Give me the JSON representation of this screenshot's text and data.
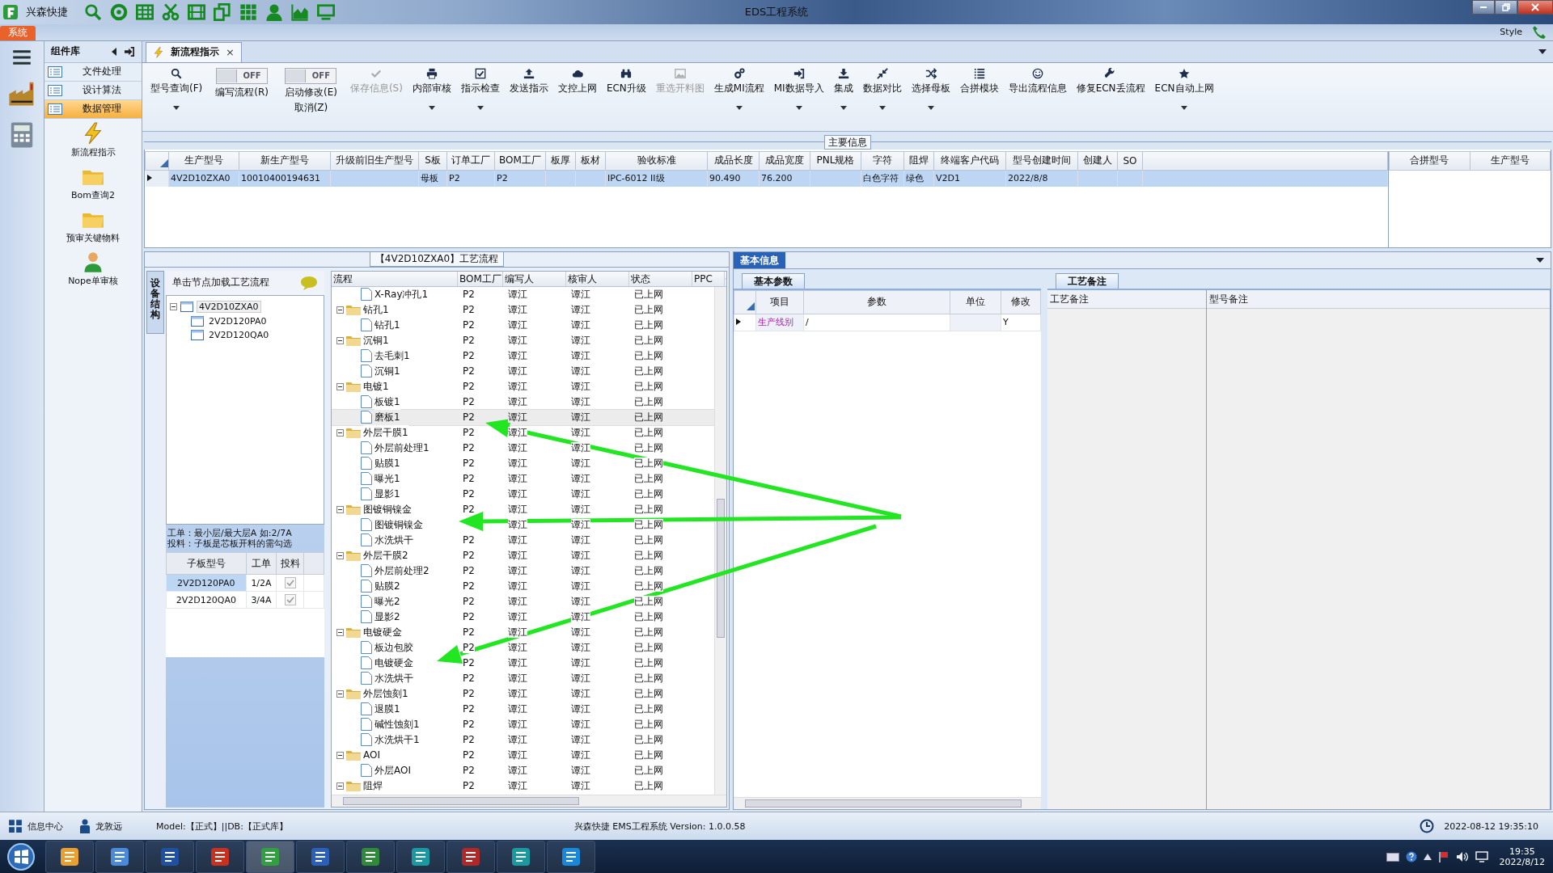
{
  "title_bar": {
    "app_name": "兴森快捷",
    "title": "EDS工程系统"
  },
  "ribbon": {
    "tab": "系统",
    "style_menu": "Style"
  },
  "component_panel": {
    "title": "组件库",
    "categories": [
      {
        "label": "文件处理",
        "selected": false
      },
      {
        "label": "设计算法",
        "selected": false
      },
      {
        "label": "数据管理",
        "selected": true
      }
    ],
    "modules": [
      "新流程指示",
      "Bom查询2",
      "预审关键物料",
      "Nope单审核"
    ]
  },
  "document_tab": {
    "label": "新流程指示",
    "close": "×"
  },
  "toolbar": [
    {
      "kind": "button",
      "label": "型号查询(F)",
      "dropdown": true,
      "disabled": false
    },
    {
      "kind": "toggle",
      "label": "编写流程(R)",
      "switch_text": "OFF",
      "on": false
    },
    {
      "kind": "toggle",
      "label": "启动修改(E)",
      "sublabel": "取消(Z)",
      "switch_text": "OFF",
      "on": false
    },
    {
      "kind": "button",
      "label": "保存信息(S)",
      "dropdown": false,
      "disabled": true
    },
    {
      "kind": "button",
      "label": "内部审核",
      "dropdown": true,
      "disabled": false
    },
    {
      "kind": "button",
      "label": "指示检查",
      "dropdown": true,
      "disabled": false
    },
    {
      "kind": "button",
      "label": "发送指示",
      "dropdown": false,
      "disabled": false
    },
    {
      "kind": "button",
      "label": "文控上网",
      "dropdown": false,
      "disabled": false
    },
    {
      "kind": "button",
      "label": "ECN升级",
      "dropdown": false,
      "disabled": false
    },
    {
      "kind": "button",
      "label": "重选开料图",
      "dropdown": false,
      "disabled": true
    },
    {
      "kind": "button",
      "label": "生成MI流程",
      "dropdown": true,
      "disabled": false
    },
    {
      "kind": "button",
      "label": "MI数据导入",
      "dropdown": true,
      "disabled": false
    },
    {
      "kind": "button",
      "label": "集成",
      "dropdown": true,
      "disabled": false
    },
    {
      "kind": "button",
      "label": "数据对比",
      "dropdown": true,
      "disabled": false
    },
    {
      "kind": "button",
      "label": "选择母板",
      "dropdown": true,
      "disabled": false
    },
    {
      "kind": "button",
      "label": "合拼模块",
      "dropdown": false,
      "disabled": false
    },
    {
      "kind": "button",
      "label": "导出流程信息",
      "dropdown": false,
      "disabled": false
    },
    {
      "kind": "button",
      "label": "修复ECN丢流程",
      "dropdown": false,
      "disabled": false
    },
    {
      "kind": "button",
      "label": "ECN自动上网",
      "dropdown": true,
      "disabled": false
    }
  ],
  "main_info": {
    "title": "主要信息",
    "columns": [
      "生产型号",
      "新生产型号",
      "升级前旧生产型号",
      "S板",
      "订单工厂",
      "BOM工厂",
      "板厚",
      "板材",
      "验收标准",
      "成品长度",
      "成品宽度",
      "PNL规格",
      "字符",
      "阻焊",
      "终端客户代码",
      "型号创建时间",
      "创建人",
      "SO"
    ],
    "rows": [
      {
        "selected": true,
        "cells": [
          "4V2D10ZXA0",
          "10010400194631",
          null,
          "母板",
          "P2",
          "P2",
          null,
          null,
          "IPC-6012 II级",
          "90.490",
          "76.200",
          null,
          "白色字符",
          "绿色",
          "V2D1",
          "2022/8/8",
          null,
          null
        ]
      }
    ],
    "merge_table": {
      "columns": [
        "合拼型号",
        "生产型号"
      ]
    }
  },
  "process_panel": {
    "title": "【4V2D10ZXA0】工艺流程",
    "side_tab": "设备结构",
    "tree_header": "单击节点加载工艺流程",
    "tree": [
      {
        "label": "4V2D10ZXA0",
        "expanded": true,
        "selected": true,
        "children": [
          {
            "label": "2V2D120PA0",
            "selected": false
          },
          {
            "label": "2V2D120QA0",
            "selected": false
          }
        ]
      }
    ],
    "note": [
      "工单：最小层/最大层A 如:2/7A",
      "投料：子板是芯板开料的需勾选"
    ],
    "sub_boards": {
      "columns": [
        "子板型号",
        "工单",
        "投料"
      ],
      "rows": [
        {
          "board": "2V2D120PA0",
          "order": "1/2A",
          "feed": true,
          "selected": true
        },
        {
          "board": "2V2D120QA0",
          "order": "3/4A",
          "feed": true,
          "selected": false
        }
      ]
    },
    "flow": {
      "columns": [
        "流程",
        "BOM工厂",
        "编写人",
        "核审人",
        "状态",
        "PPC"
      ],
      "steps": [
        {
          "kind": "folder",
          "children": [
            {
              "kind": "step",
              "label": "X-Ray冲孔1",
              "bom": "P2",
              "writer": "谭江",
              "reviewer": "谭江",
              "status": "已上网",
              "selected": false
            }
          ]
        },
        {
          "kind": "folder",
          "label": "钻孔1",
          "bom": "P2",
          "writer": "谭江",
          "reviewer": "谭江",
          "status": "已上网",
          "selected": false,
          "expanded": true,
          "children": [
            {
              "kind": "step",
              "label": "钻孔1",
              "bom": "P2",
              "writer": "谭江",
              "reviewer": "谭江",
              "status": "已上网",
              "selected": false
            }
          ]
        },
        {
          "kind": "folder",
          "label": "沉铜1",
          "bom": "P2",
          "writer": "谭江",
          "reviewer": "谭江",
          "status": "已上网",
          "selected": false,
          "expanded": true,
          "children": [
            {
              "kind": "step",
              "label": "去毛刺1",
              "bom": "P2",
              "writer": "谭江",
              "reviewer": "谭江",
              "status": "已上网",
              "selected": false
            },
            {
              "kind": "step",
              "label": "沉铜1",
              "bom": "P2",
              "writer": "谭江",
              "reviewer": "谭江",
              "status": "已上网",
              "selected": false
            }
          ]
        },
        {
          "kind": "folder",
          "label": "电镀1",
          "bom": "P2",
          "writer": "谭江",
          "reviewer": "谭江",
          "status": "已上网",
          "selected": false,
          "expanded": true,
          "children": [
            {
              "kind": "step",
              "label": "板镀1",
              "bom": "P2",
              "writer": "谭江",
              "reviewer": "谭江",
              "status": "已上网",
              "selected": false
            },
            {
              "kind": "step",
              "label": "磨板1",
              "bom": "P2",
              "writer": "谭江",
              "reviewer": "谭江",
              "status": "已上网",
              "selected": true
            }
          ]
        },
        {
          "kind": "folder",
          "label": "外层干膜1",
          "bom": "P2",
          "writer": "谭江",
          "reviewer": "谭江",
          "status": "已上网",
          "selected": false,
          "expanded": true,
          "children": [
            {
              "kind": "step",
              "label": "外层前处理1",
              "bom": "P2",
              "writer": "谭江",
              "reviewer": "谭江",
              "status": "已上网",
              "selected": false
            },
            {
              "kind": "step",
              "label": "贴膜1",
              "bom": "P2",
              "writer": "谭江",
              "reviewer": "谭江",
              "status": "已上网",
              "selected": false
            },
            {
              "kind": "step",
              "label": "曝光1",
              "bom": "P2",
              "writer": "谭江",
              "reviewer": "谭江",
              "status": "已上网",
              "selected": false
            },
            {
              "kind": "step",
              "label": "显影1",
              "bom": "P2",
              "writer": "谭江",
              "reviewer": "谭江",
              "status": "已上网",
              "selected": false
            }
          ]
        },
        {
          "kind": "folder",
          "label": "图镀铜镍金",
          "bom": "P2",
          "writer": "谭江",
          "reviewer": "谭江",
          "status": "已上网",
          "selected": false,
          "expanded": true,
          "children": [
            {
              "kind": "step",
              "label": "图镀铜镍金",
              "writer": "谭江",
              "reviewer": "谭江",
              "status": "已上网",
              "selected": false
            },
            {
              "kind": "step",
              "label": "水洗烘干",
              "bom": "P2",
              "writer": "谭江",
              "reviewer": "谭江",
              "status": "已上网",
              "selected": false
            }
          ]
        },
        {
          "kind": "folder",
          "label": "外层干膜2",
          "bom": "P2",
          "writer": "谭江",
          "reviewer": "谭江",
          "status": "已上网",
          "selected": false,
          "expanded": true,
          "children": [
            {
              "kind": "step",
              "label": "外层前处理2",
              "bom": "P2",
              "writer": "谭江",
              "reviewer": "谭江",
              "status": "已上网",
              "selected": false
            },
            {
              "kind": "step",
              "label": "贴膜2",
              "bom": "P2",
              "writer": "谭江",
              "reviewer": "谭江",
              "status": "已上网",
              "selected": false
            },
            {
              "kind": "step",
              "label": "曝光2",
              "bom": "P2",
              "writer": "谭江",
              "reviewer": "谭江",
              "status": "已上网",
              "selected": false
            },
            {
              "kind": "step",
              "label": "显影2",
              "bom": "P2",
              "writer": "谭江",
              "reviewer": "谭江",
              "status": "已上网",
              "selected": false
            }
          ]
        },
        {
          "kind": "folder",
          "label": "电镀硬金",
          "bom": "P2",
          "writer": "谭江",
          "reviewer": "谭江",
          "status": "已上网",
          "selected": false,
          "expanded": true,
          "children": [
            {
              "kind": "step",
              "label": "板边包胶",
              "bom": "P2",
              "writer": "谭江",
              "reviewer": "谭江",
              "status": "已上网",
              "selected": false
            },
            {
              "kind": "step",
              "label": "电镀硬金",
              "bom": "P2",
              "writer": "谭江",
              "reviewer": "谭江",
              "status": "已上网",
              "selected": false
            },
            {
              "kind": "step",
              "label": "水洗烘干",
              "bom": "P2",
              "writer": "谭江",
              "reviewer": "谭江",
              "status": "已上网",
              "selected": false
            }
          ]
        },
        {
          "kind": "folder",
          "label": "外层蚀刻1",
          "bom": "P2",
          "writer": "谭江",
          "reviewer": "谭江",
          "status": "已上网",
          "selected": false,
          "expanded": true,
          "children": [
            {
              "kind": "step",
              "label": "退膜1",
              "bom": "P2",
              "writer": "谭江",
              "reviewer": "谭江",
              "status": "已上网",
              "selected": false
            },
            {
              "kind": "step",
              "label": "碱性蚀刻1",
              "bom": "P2",
              "writer": "谭江",
              "reviewer": "谭江",
              "status": "已上网",
              "selected": false
            },
            {
              "kind": "step",
              "label": "水洗烘干1",
              "bom": "P2",
              "writer": "谭江",
              "reviewer": "谭江",
              "status": "已上网",
              "selected": false
            }
          ]
        },
        {
          "kind": "folder",
          "label": "AOI",
          "bom": "P2",
          "writer": "谭江",
          "reviewer": "谭江",
          "status": "已上网",
          "selected": false,
          "expanded": true,
          "children": [
            {
              "kind": "step",
              "label": "外层AOI",
              "bom": "P2",
              "writer": "谭江",
              "reviewer": "谭江",
              "status": "已上网",
              "selected": false
            }
          ]
        },
        {
          "kind": "folder",
          "label": "阻焊",
          "bom": "P2",
          "writer": "谭江",
          "reviewer": "谭江",
          "status": "已上网",
          "selected": false,
          "expanded": true
        }
      ]
    }
  },
  "basic_info": {
    "tab": "基本信息",
    "sub_tab": "基本参数",
    "columns": [
      "项目",
      "参数",
      "单位",
      "修改"
    ],
    "rows": [
      {
        "item": "生产线别",
        "value": "/",
        "modified": "Y",
        "selected": true
      }
    ]
  },
  "remarks": {
    "tab": "工艺备注",
    "columns": [
      "工艺备注",
      "型号备注"
    ]
  },
  "status_bar": {
    "info_center": "信息中心",
    "user": "龙敦远",
    "model": "Model:【正式】||DB:【正式库】",
    "product": "兴森快捷 EMS工程系统 Version: 1.0.0.58",
    "datetime": "2022-08-12 19:35:10"
  },
  "taskbar": {
    "time": "19:35",
    "date": "2022/8/12"
  }
}
